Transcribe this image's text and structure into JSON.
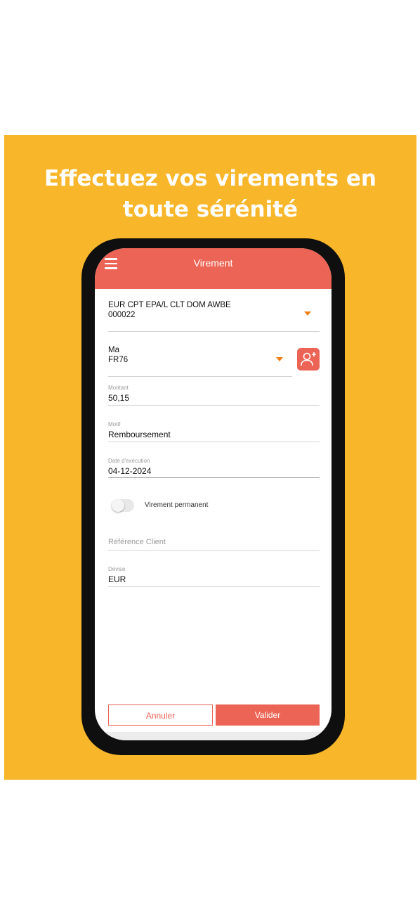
{
  "promo": {
    "headline_line1": "Effectuez vos virements en",
    "headline_line2": "toute sérénité",
    "background_color": "#F8B62A"
  },
  "app": {
    "title": "Virement",
    "accent_color": "#EC6455",
    "caret_color": "#F07F16",
    "menu_icon": "hamburger-menu-icon"
  },
  "form": {
    "debit_account": {
      "line1": "EUR CPT EPA/L CLT DOM AWBE",
      "line2": "000022"
    },
    "beneficiary": {
      "line1": "Ma",
      "line2": "FR76",
      "contact_icon": "add-contact-icon"
    },
    "amount": {
      "label": "Montant",
      "value": "50,15"
    },
    "reason": {
      "label": "Motif",
      "value": "Remboursement"
    },
    "execution_date": {
      "label": "Date d'exécution",
      "value": "04-12-2024"
    },
    "permanent_transfer": {
      "label": "Virement permanent",
      "enabled": false
    },
    "client_reference": {
      "placeholder": "Référence Client"
    },
    "currency": {
      "label": "Devise",
      "value": "EUR"
    }
  },
  "actions": {
    "cancel_label": "Annuler",
    "submit_label": "Valider"
  }
}
